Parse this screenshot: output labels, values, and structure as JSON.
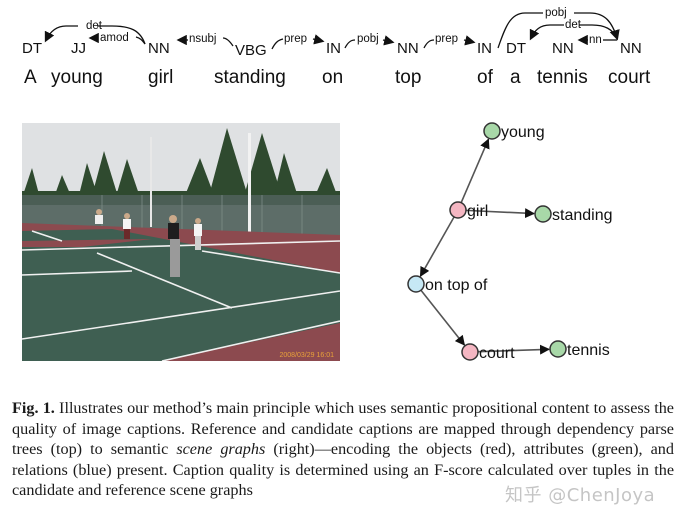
{
  "dependency_parse": {
    "tokens": [
      {
        "word": "A",
        "tag": "DT"
      },
      {
        "word": "young",
        "tag": "JJ"
      },
      {
        "word": "girl",
        "tag": "NN"
      },
      {
        "word": "standing",
        "tag": "VBG"
      },
      {
        "word": "on",
        "tag": "IN"
      },
      {
        "word": "top",
        "tag": "NN"
      },
      {
        "word": "of",
        "tag": "IN"
      },
      {
        "word": "a",
        "tag": "DT"
      },
      {
        "word": "tennis",
        "tag": "NN"
      },
      {
        "word": "court",
        "tag": "NN"
      }
    ],
    "relations": [
      {
        "label": "det",
        "from": "girl",
        "to": "A"
      },
      {
        "label": "amod",
        "from": "girl",
        "to": "young"
      },
      {
        "label": "nsubj",
        "from": "standing",
        "to": "girl"
      },
      {
        "label": "prep",
        "from": "standing",
        "to": "on"
      },
      {
        "label": "pobj",
        "from": "on",
        "to": "top"
      },
      {
        "label": "prep",
        "from": "top",
        "to": "of"
      },
      {
        "label": "pobj",
        "from": "of",
        "to": "court"
      },
      {
        "label": "det",
        "from": "court",
        "to": "a"
      },
      {
        "label": "nn",
        "from": "court",
        "to": "tennis"
      }
    ]
  },
  "photo": {
    "description": "Girls playing tennis on an outdoor green and red tennis court with trees and fence",
    "timestamp": "2008/03/29 16:01"
  },
  "scene_graph": {
    "colors": {
      "object": "#f4b6c2",
      "attribute": "#a8d8a8",
      "relation": "#c6e8f5",
      "stroke": "#333333"
    },
    "nodes": [
      {
        "id": "young",
        "label": "young",
        "type": "attribute"
      },
      {
        "id": "girl",
        "label": "girl",
        "type": "object"
      },
      {
        "id": "standing",
        "label": "standing",
        "type": "attribute"
      },
      {
        "id": "ontopof",
        "label": "on top of",
        "type": "relation"
      },
      {
        "id": "court",
        "label": "court",
        "type": "object"
      },
      {
        "id": "tennis",
        "label": "tennis",
        "type": "attribute"
      }
    ],
    "edges": [
      {
        "from": "girl",
        "to": "young"
      },
      {
        "from": "girl",
        "to": "standing"
      },
      {
        "from": "girl",
        "to": "ontopof"
      },
      {
        "from": "ontopof",
        "to": "court"
      },
      {
        "from": "court",
        "to": "tennis"
      }
    ]
  },
  "caption": {
    "fig_label": "Fig. 1.",
    "text_1": " Illustrates our method’s main principle which uses semantic propositional content to assess the quality of image captions. Reference and candidate captions are mapped through dependency parse trees (top) to semantic ",
    "italic": "scene graphs",
    "text_2": " (right)—encoding the objects (red), attributes (green), and relations (blue) present. Caption quality is determined using an F-score calculated over tuples in the candidate and reference scene graphs"
  },
  "watermark": "知乎 @ChenJoya"
}
